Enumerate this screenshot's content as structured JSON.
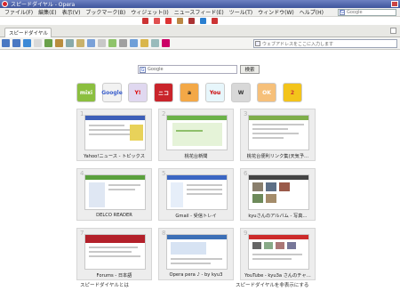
{
  "window": {
    "title": "スピードダイヤル - Opera"
  },
  "menubar": {
    "items": [
      "ファイル(F)",
      "編集(E)",
      "表示(V)",
      "ブックマーク(B)",
      "ウィジェット(I)",
      "ニュースフィード(E)",
      "ツール(T)",
      "ウィンドウ(W)",
      "ヘルプ(H)"
    ],
    "search_placeholder": "Google"
  },
  "tabs": [
    {
      "label": "スピードダイヤル"
    }
  ],
  "address_bar": {
    "placeholder": "ウェブアドレスをここに入力します"
  },
  "search": {
    "placeholder": "Google",
    "button_label": "検索"
  },
  "quick_icons": [
    {
      "name": "mixi-icon",
      "label": "mixi",
      "color": "#8bbf3f"
    },
    {
      "name": "google-icon",
      "label": "Google",
      "color": "#f2f2f2"
    },
    {
      "name": "yahoo-icon",
      "label": "Y!",
      "color": "#e0d8f0"
    },
    {
      "name": "nico-icon",
      "label": "ニコ",
      "color": "#c9242b"
    },
    {
      "name": "amazon-icon",
      "label": "a",
      "color": "#f3a847"
    },
    {
      "name": "youtube-icon",
      "label": "You",
      "color": "#e7f6fb"
    },
    {
      "name": "wiki-icon",
      "label": "W",
      "color": "#d8d8d8"
    },
    {
      "name": "okwave-icon",
      "label": "OK",
      "color": "#f6c07a"
    },
    {
      "name": "two-ch-icon",
      "label": "2",
      "color": "#f3c41b"
    }
  ],
  "speed_dials": [
    {
      "num": "1",
      "caption": "Yahoo!ニュース - トピックス",
      "theme": "#3d5fb8"
    },
    {
      "num": "2",
      "caption": "桃花台新聞",
      "theme": "#6cb24a"
    },
    {
      "num": "3",
      "caption": "桃花台便利リンク集(天気予…",
      "theme": "#7fae4b"
    },
    {
      "num": "4",
      "caption": "DELCO READER",
      "theme": "#5aa03c"
    },
    {
      "num": "5",
      "caption": "Gmail - 受信トレイ",
      "theme": "#3a66c3"
    },
    {
      "num": "6",
      "caption": "kyuさんのアルバム - 写真…",
      "theme": "#444444"
    },
    {
      "num": "7",
      "caption": "Forums - 日本語",
      "theme": "#b3202a"
    },
    {
      "num": "8",
      "caption": "Opera pera ♪ - by kyu3",
      "theme": "#3c6fb6"
    },
    {
      "num": "9",
      "caption": "YouTube - kyu3a さんのチャ…",
      "theme": "#cc2a2a"
    }
  ],
  "footer": {
    "left": "スピードダイヤルとは",
    "right": "スピードダイヤルを非表示にする"
  }
}
